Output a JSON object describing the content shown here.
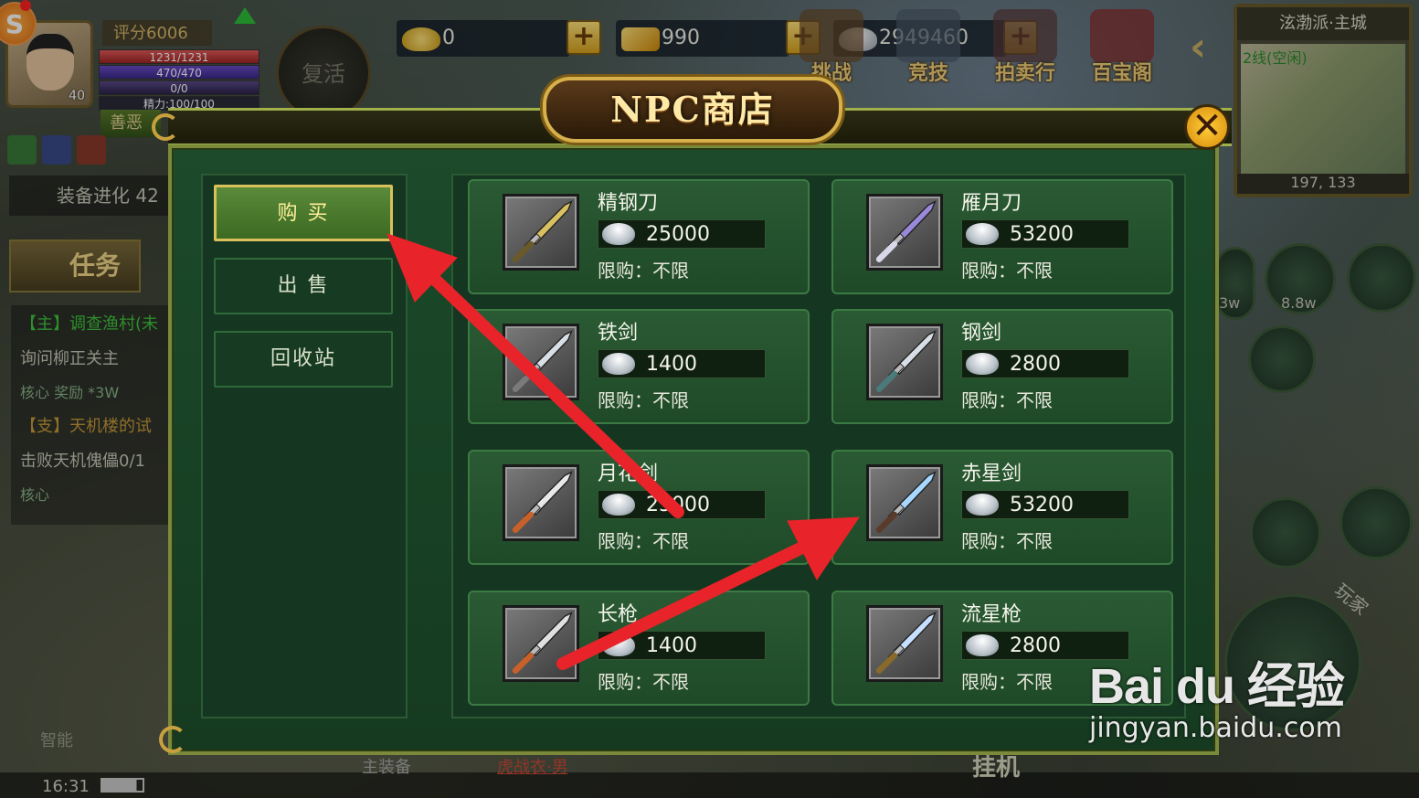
{
  "player": {
    "score_label": "评分6006",
    "level": "40",
    "hp": "1231/1231",
    "mp": "470/470",
    "xp": "0/0",
    "energy": "精力:100/100",
    "karma": "善恶",
    "revive": "复活"
  },
  "currencies": [
    {
      "name": "gold-ingot",
      "value": "0",
      "color": "#f5c842"
    },
    {
      "name": "gold-bar",
      "value": "990",
      "color": "#f3b41a"
    },
    {
      "name": "silver",
      "value": "2949460",
      "color": "#d8dee6"
    }
  ],
  "top_nav": [
    {
      "label": "挑战"
    },
    {
      "label": "竞技"
    },
    {
      "label": "拍卖行"
    },
    {
      "label": "百宝阁"
    }
  ],
  "minimap": {
    "title": "泫渤派·主城",
    "line": "2线(空闲)",
    "coords": "197, 133"
  },
  "hud_left": {
    "equip_evolve": "装备进化 42",
    "task_tab": "任务",
    "quests": [
      {
        "text": "【主】调查渔村(未",
        "kind": "main"
      },
      {
        "text": "询问柳正关主",
        "kind": "desc"
      },
      {
        "text": "核心 奖励 *3W",
        "kind": "reward"
      },
      {
        "text": "【支】天机楼的试",
        "kind": "sub"
      },
      {
        "text": "击败天机傀儡0/1",
        "kind": "desc"
      },
      {
        "text": "核心",
        "kind": "reward"
      }
    ],
    "smart": "智能"
  },
  "bottom": {
    "clock": "16:31",
    "main_equip": "主装备",
    "chat": "虎战衣·男",
    "idle": "挂机"
  },
  "right_hud": {
    "price_a": "3w",
    "price_b": "8.8w",
    "player": "玩家"
  },
  "shop": {
    "title": "NPC商店",
    "close": "✕",
    "tabs": [
      {
        "label": "购 买",
        "active": true
      },
      {
        "label": "出 售",
        "active": false
      },
      {
        "label": "回收站",
        "active": false
      }
    ],
    "items": [
      {
        "name": "精钢刀",
        "price": "25000",
        "limit": "限购：不限",
        "blade": "#d8c060",
        "hilt": "#6a5a2a"
      },
      {
        "name": "雁月刀",
        "price": "53200",
        "limit": "限购：不限",
        "blade": "#9a88d8",
        "hilt": "#d8d8e8"
      },
      {
        "name": "铁剑",
        "price": "1400",
        "limit": "限购：不限",
        "blade": "#d8dee6",
        "hilt": "#7a7a7a"
      },
      {
        "name": "钢剑",
        "price": "2800",
        "limit": "限购：不限",
        "blade": "#d8dee6",
        "hilt": "#4a7a7a"
      },
      {
        "name": "月花剑",
        "price": "25000",
        "limit": "限购：不限",
        "blade": "#e8e8e8",
        "hilt": "#c8602a"
      },
      {
        "name": "赤星剑",
        "price": "53200",
        "limit": "限购：不限",
        "blade": "#a8d8ff",
        "hilt": "#5a3a2a"
      },
      {
        "name": "长枪",
        "price": "1400",
        "limit": "限购：不限",
        "blade": "#e0e0e0",
        "hilt": "#c8602a"
      },
      {
        "name": "流星枪",
        "price": "2800",
        "limit": "限购：不限",
        "blade": "#c8e0ff",
        "hilt": "#8a6a2a"
      }
    ]
  },
  "watermark": {
    "brand": "Bai du 经验",
    "url": "jingyan.baidu.com"
  },
  "colors": {
    "accent_gold": "#d6b04a",
    "panel_green": "#1f4a28",
    "arrow_red": "#e8242a"
  }
}
